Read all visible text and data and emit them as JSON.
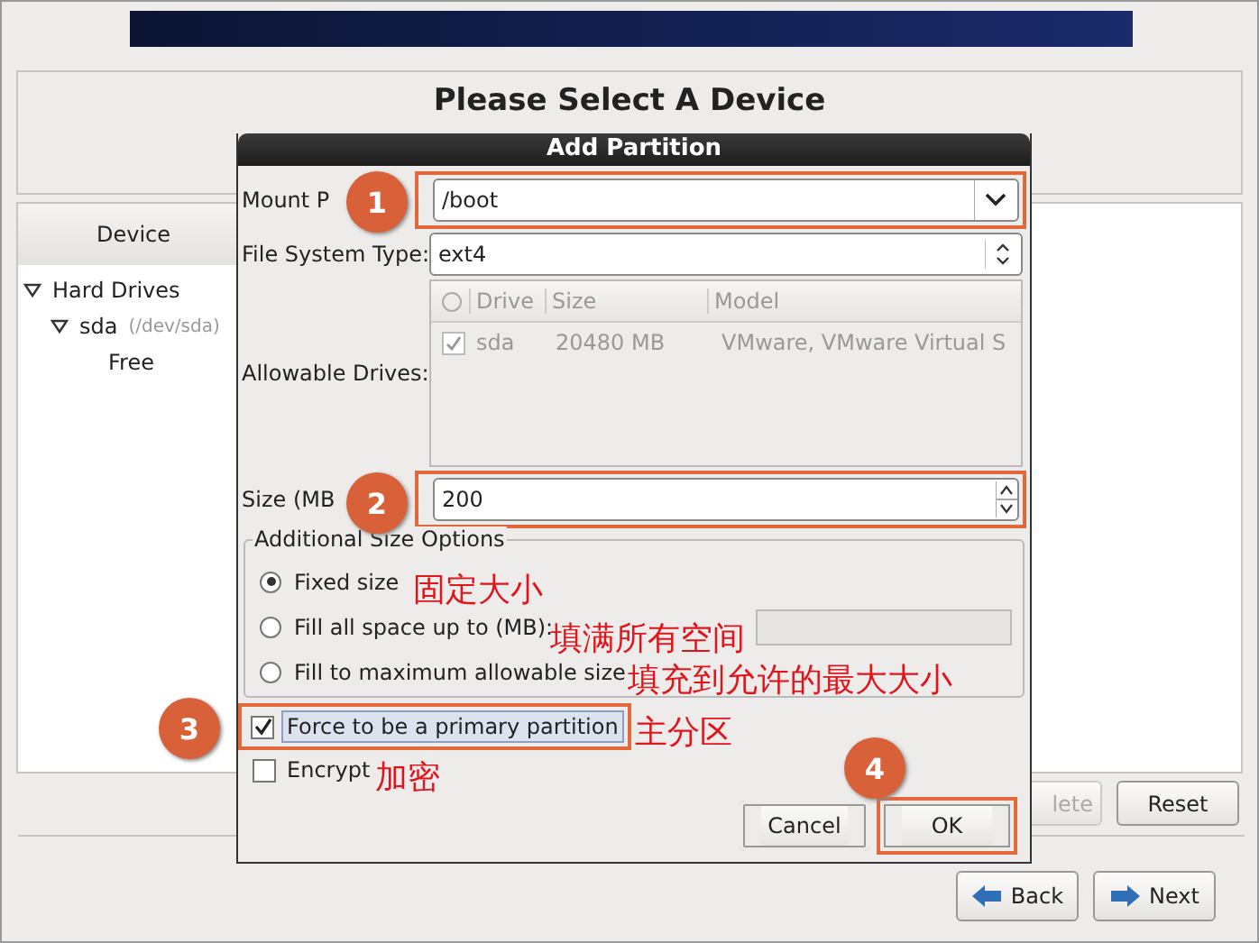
{
  "header": {
    "title": "Please Select A Device"
  },
  "device_panel": {
    "column": "Device",
    "tree": [
      {
        "label": "Hard Drives",
        "expanded": true,
        "children": [
          {
            "label": "sda",
            "detail": "(/dev/sda)",
            "expanded": true,
            "children": [
              {
                "label": "Free"
              }
            ]
          }
        ]
      }
    ]
  },
  "panel_buttons": [
    {
      "label": "lete",
      "disabled": true
    },
    {
      "label": "Reset",
      "disabled": false
    }
  ],
  "nav_buttons": [
    {
      "label": "Back",
      "kind": "back"
    },
    {
      "label": "Next",
      "kind": "next"
    }
  ],
  "dialog": {
    "title": "Add Partition",
    "mount_point": {
      "label": "Mount P",
      "value": "/boot",
      "highlighted": true
    },
    "fs_type": {
      "label": "File System Type:",
      "value": "ext4"
    },
    "drives": {
      "label": "Allowable Drives:",
      "columns": [
        "Drive",
        "Size",
        "Model"
      ],
      "rows": [
        {
          "checked": true,
          "cells": [
            "sda",
            "20480 MB",
            "VMware, VMware Virtual S"
          ]
        }
      ]
    },
    "size": {
      "label": "Size (MB",
      "value": "200",
      "highlighted": true
    },
    "size_options": {
      "title": "Additional Size Options",
      "options": [
        {
          "label": "Fixed size",
          "selected": true,
          "kind": "plain"
        },
        {
          "label": "Fill all space up to (MB):",
          "selected": false,
          "kind": "spin"
        },
        {
          "label": "Fill to maximum allowable size",
          "selected": false,
          "kind": "plain"
        }
      ]
    },
    "primary": {
      "label": "Force to be a primary partition",
      "checked": true,
      "highlighted": true
    },
    "encrypt": {
      "label": "Encrypt",
      "checked": false
    },
    "buttons": [
      {
        "label": "Cancel",
        "highlighted": false
      },
      {
        "label": "OK",
        "highlighted": true
      }
    ]
  },
  "annotations": [
    {
      "number": "1",
      "kind": "mount"
    },
    {
      "number": "2",
      "kind": "size"
    },
    {
      "number": "3",
      "kind": "primary"
    },
    {
      "number": "4",
      "kind": "ok"
    }
  ],
  "notes": [
    {
      "text": "固定大小",
      "kind": "fixed"
    },
    {
      "text": "填满所有空间",
      "kind": "fill"
    },
    {
      "text": "填充到允许的最大大小",
      "kind": "max"
    },
    {
      "text": "主分区",
      "kind": "primary"
    },
    {
      "text": "加密",
      "kind": "encrypt"
    }
  ]
}
